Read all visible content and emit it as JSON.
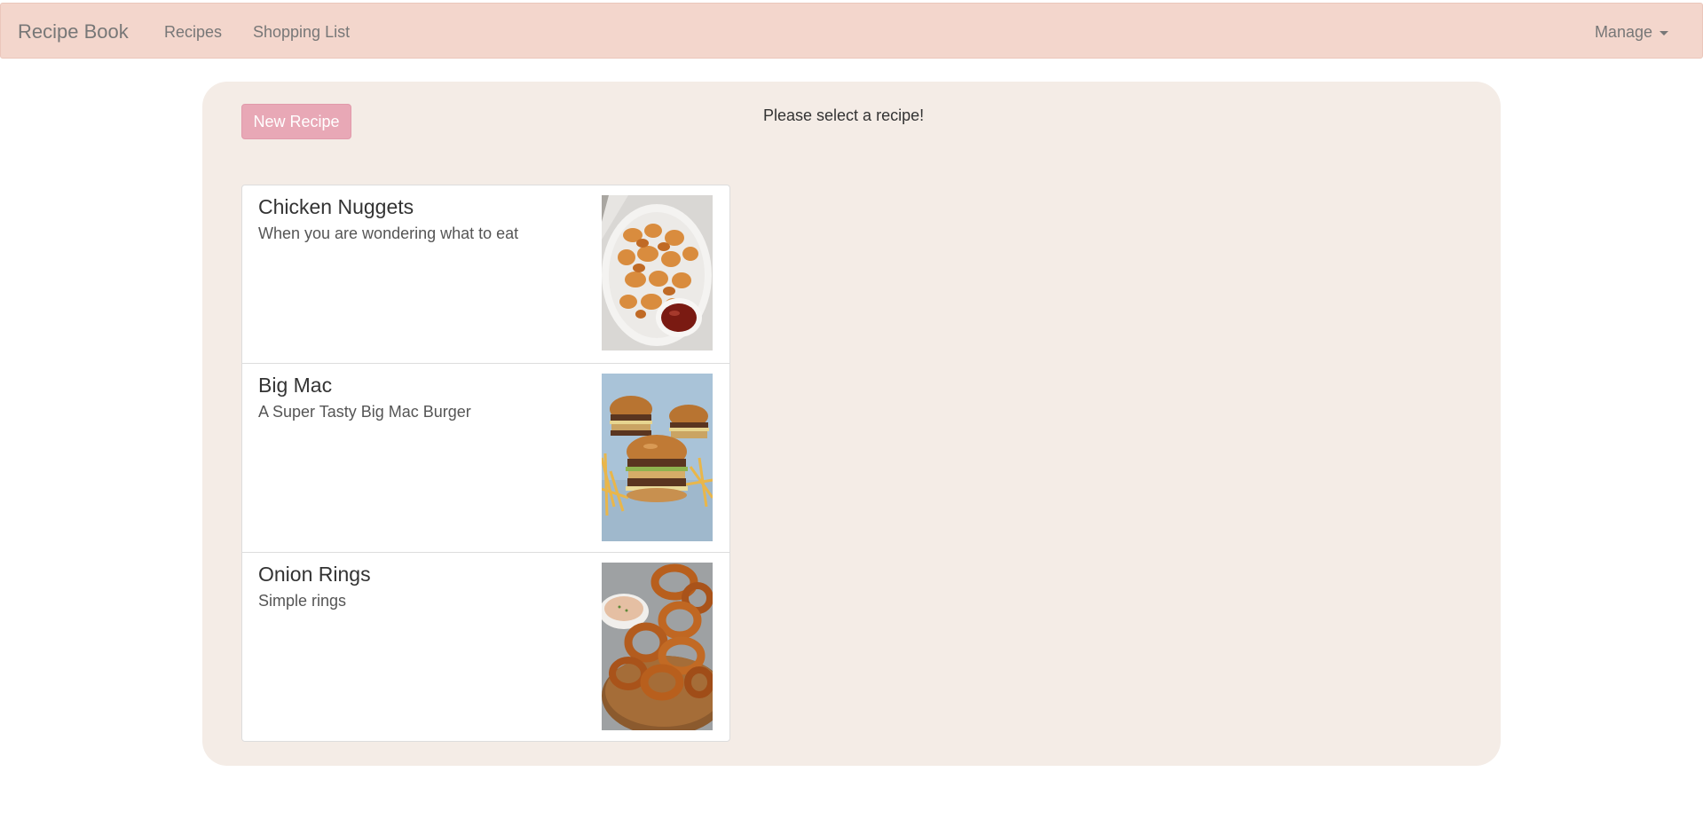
{
  "navbar": {
    "brand": "Recipe Book",
    "links": [
      "Recipes",
      "Shopping List"
    ],
    "manage": "Manage",
    "background": "#f3d6cc"
  },
  "panel": {
    "new_recipe_label": "New Recipe",
    "select_message": "Please select a recipe!",
    "background": "#f4ece6"
  },
  "recipes": [
    {
      "name": "Chicken Nuggets",
      "description": "When you are wondering what to eat",
      "image": "chicken-nuggets-photo"
    },
    {
      "name": "Big Mac",
      "description": "A Super Tasty Big Mac Burger",
      "image": "big-mac-photo"
    },
    {
      "name": "Onion Rings",
      "description": "Simple rings",
      "image": "onion-rings-photo"
    }
  ]
}
